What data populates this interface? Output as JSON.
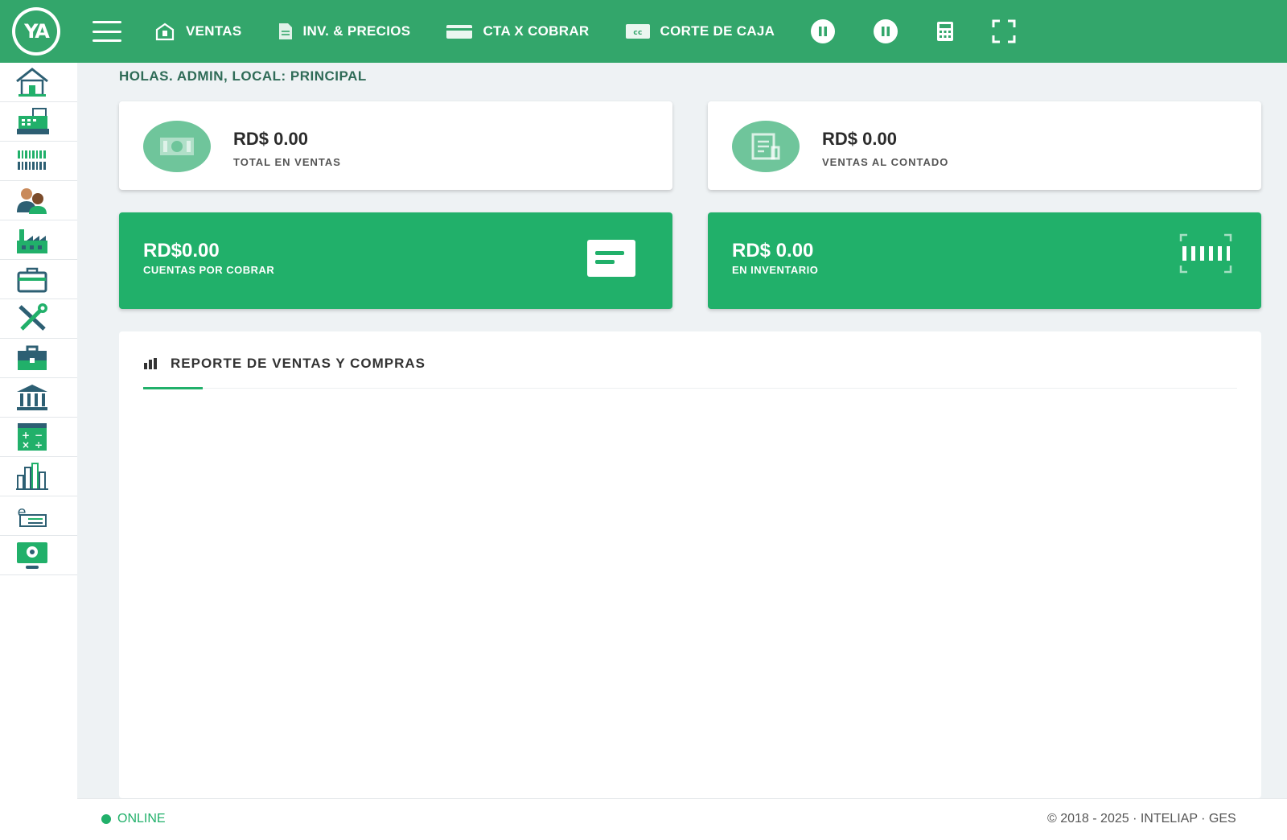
{
  "header": {
    "logo_text": "YA",
    "nav": [
      {
        "label": "VENTAS",
        "icon": "register-icon"
      },
      {
        "label": "INV. & PRECIOS",
        "icon": "document-icon"
      },
      {
        "label": "CTA X COBRAR",
        "icon": "credit-card-icon"
      },
      {
        "label": "CORTE DE CAJA",
        "icon": "cash-cut-icon"
      }
    ],
    "icons": [
      "pause-icon",
      "pause-icon",
      "calculator-icon",
      "fullscreen-icon"
    ]
  },
  "sidebar": {
    "items": [
      "home-icon",
      "cash-register-icon",
      "barcode-icon",
      "users-icon",
      "factory-icon",
      "suitcase-icon",
      "tools-icon",
      "briefcase-icon",
      "bank-icon",
      "calculator-icon",
      "chart-icon",
      "ecommerce-icon",
      "monitor-settings-icon"
    ]
  },
  "greeting": "HOLAS. ADMIN, LOCAL: PRINCIPAL",
  "cards": {
    "total_ventas": {
      "value": "RD$ 0.00",
      "label": "TOTAL EN VENTAS"
    },
    "ventas_contado": {
      "value": "RD$ 0.00",
      "label": "VENTAS AL CONTADO"
    },
    "cuentas_cobrar": {
      "value": "RD$0.00",
      "label": "CUENTAS POR COBRAR"
    },
    "inventario": {
      "value": "RD$ 0.00",
      "label": "EN INVENTARIO"
    }
  },
  "report": {
    "title": "REPORTE DE VENTAS Y COMPRAS"
  },
  "footer": {
    "status": "ONLINE",
    "copyright": "© 2018 - 2025 · INTELIAP · GES"
  },
  "colors": {
    "primary": "#33a66b",
    "accent": "#21b06a",
    "soft": "#6fc59b"
  }
}
